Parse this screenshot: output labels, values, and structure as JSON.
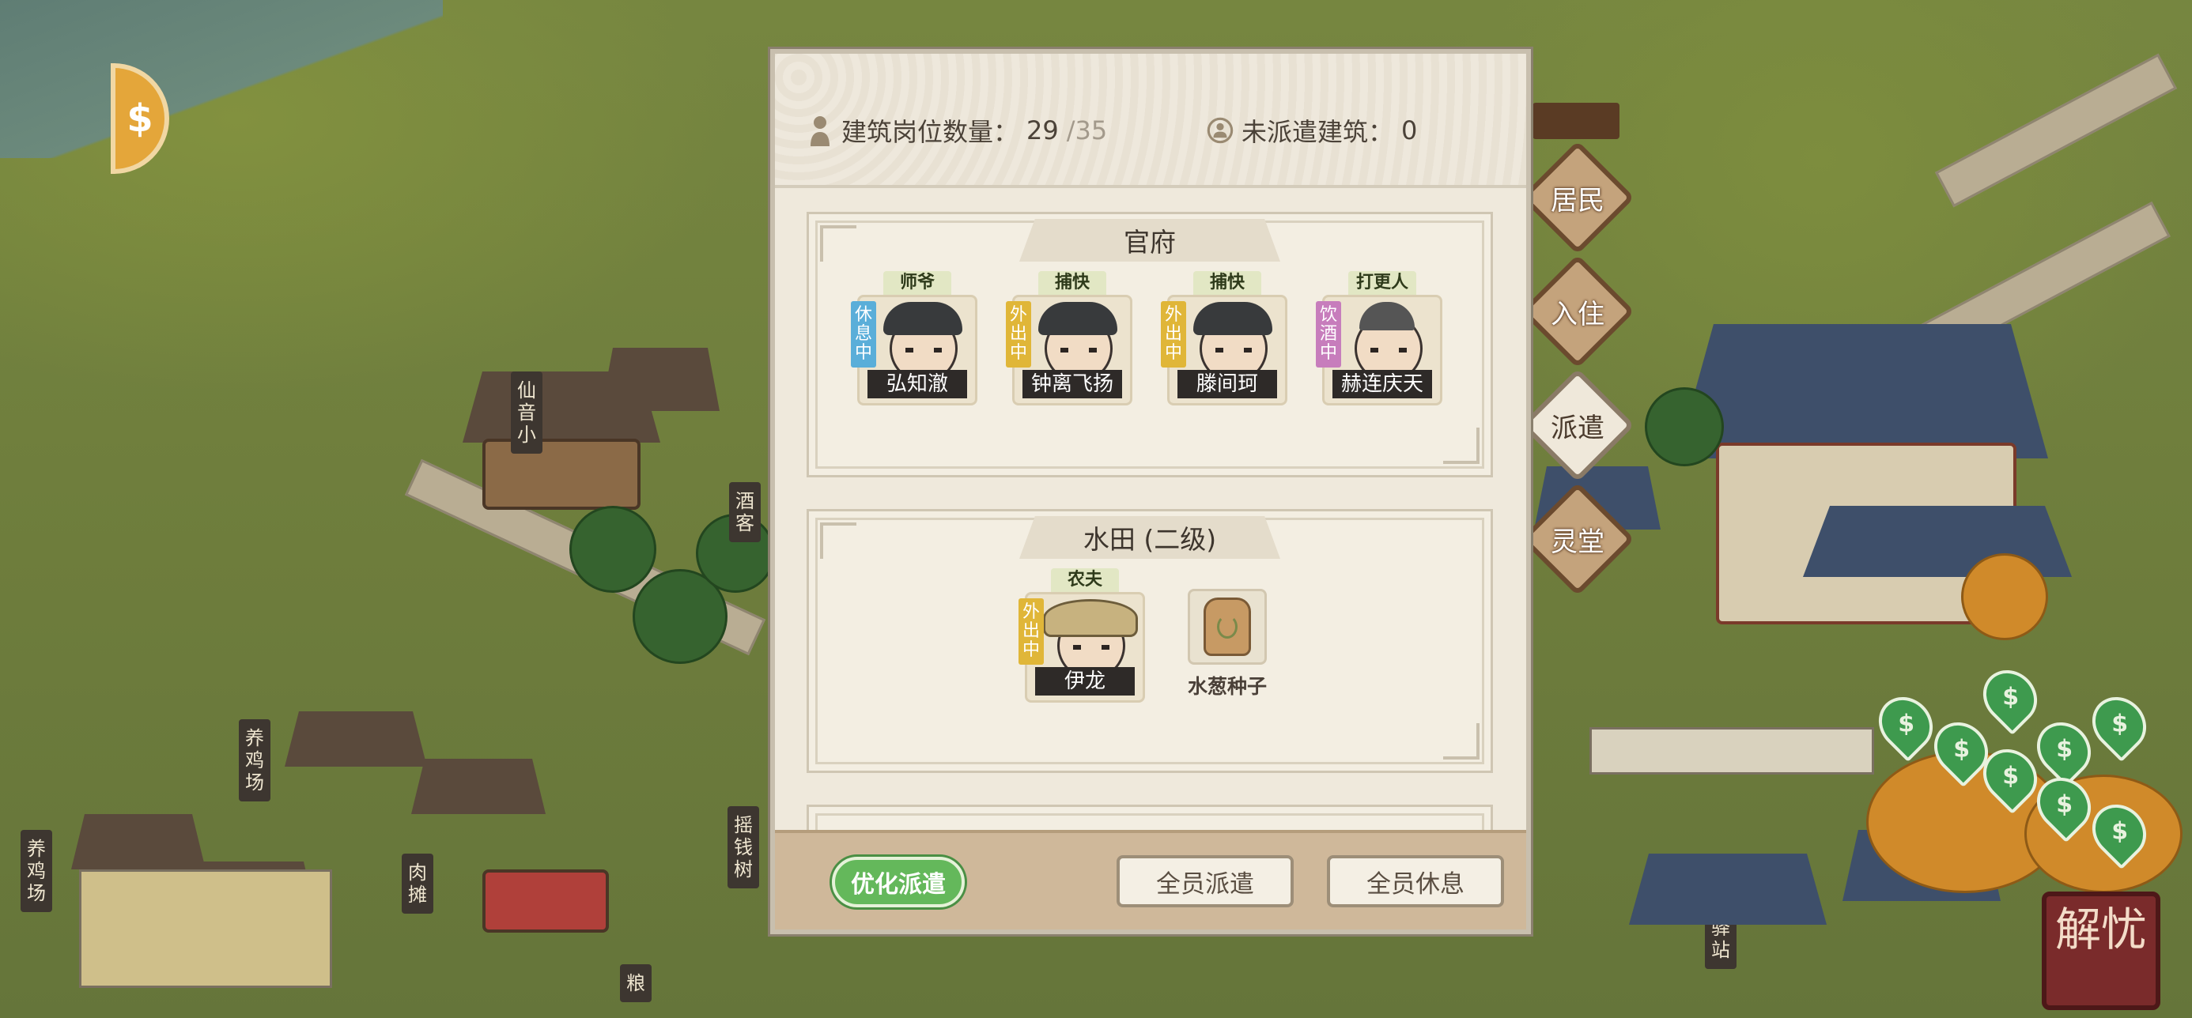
{
  "header": {
    "posts_label": "建筑岗位数量：",
    "posts_filled": "29",
    "posts_total": "/35",
    "undispatched_label": "未派遣建筑：",
    "undispatched_count": "0"
  },
  "sections": [
    {
      "title": "官府",
      "workers": [
        {
          "role": "师爷",
          "name": "弘知澈",
          "status": "休息中"
        },
        {
          "role": "捕快",
          "name": "钟离飞扬",
          "status": "外出中"
        },
        {
          "role": "捕快",
          "name": "滕间珂",
          "status": "外出中"
        },
        {
          "role": "打更人",
          "name": "赫连庆天",
          "status": "饮酒中"
        }
      ]
    },
    {
      "title": "水田 (二级)",
      "workers": [
        {
          "role": "农夫",
          "name": "伊龙",
          "status": "外出中"
        }
      ],
      "seed": "水葱种子"
    }
  ],
  "footer": {
    "optimize_label": "优化派遣",
    "dispatch_all_label": "全员派遣",
    "rest_all_label": "全员休息"
  },
  "side_nav": [
    "居民",
    "入住",
    "派遣",
    "灵堂"
  ],
  "side_nav_active": "派遣",
  "map_labels": {
    "xianyin": "仙音小",
    "jiuke": "酒客",
    "yangji1": "养鸡场",
    "yangji2": "养鸡场",
    "routan": "肉摊",
    "yaoqian": "摇钱树",
    "liang": "粮",
    "yizhan": "驿站"
  },
  "seal_text": "解忧",
  "colors": {
    "status_rest": "#5aaed9",
    "status_out": "#e0b638",
    "status_drink": "#c77dbc",
    "optimize_green": "#64b85b"
  }
}
